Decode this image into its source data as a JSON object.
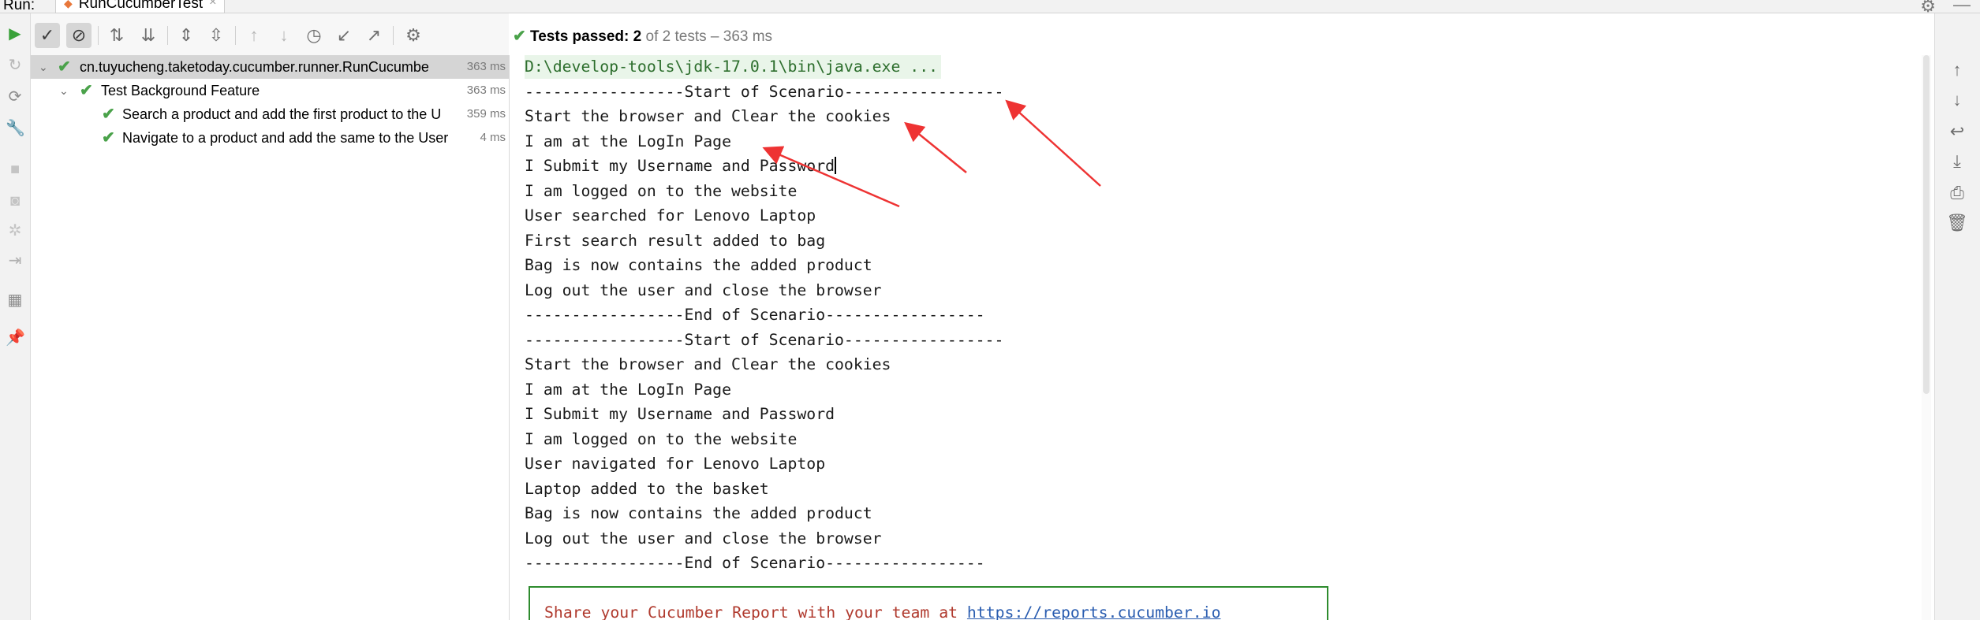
{
  "topbar": {
    "run_label": "Run:",
    "tab_label": "RunCucumberTest",
    "tab_close": "×"
  },
  "toolbar": {
    "icons": [
      "show-passed-icon",
      "show-ignored-icon",
      "sort-alpha-icon",
      "sort-duration-icon",
      "expand-all-icon",
      "collapse-all-icon",
      "prev-failed-icon",
      "next-failed-icon",
      "history-icon",
      "import-tests-icon",
      "export-tests-icon",
      "settings-icon"
    ]
  },
  "status": {
    "label": "Tests passed:",
    "passed": "2",
    "of_total": "of 2 tests",
    "separator": "–",
    "duration": "363 ms"
  },
  "tree": {
    "root": {
      "name": "cn.tuyucheng.taketoday.cucumber.runner.RunCucumbe",
      "duration": "363 ms"
    },
    "feature": {
      "name": "Test Background Feature",
      "duration": "363 ms"
    },
    "tests": [
      {
        "name": "Search a product and add the first product to the U",
        "duration": "359 ms"
      },
      {
        "name": "Navigate to a product and add the same to the User",
        "duration": "4 ms"
      }
    ]
  },
  "console": {
    "command": "D:\\develop-tools\\jdk-17.0.1\\bin\\java.exe ...",
    "lines": [
      "-----------------Start of Scenario-----------------",
      "Start the browser and Clear the cookies",
      "I am at the LogIn Page",
      "I Submit my Username and Password",
      "I am logged on to the website",
      "User searched for Lenovo Laptop",
      "First search result added to bag",
      "Bag is now contains the added product",
      "Log out the user and close the browser",
      "-----------------End of Scenario-----------------",
      "-----------------Start of Scenario-----------------",
      "Start the browser and Clear the cookies",
      "I am at the LogIn Page",
      "I Submit my Username and Password",
      "I am logged on to the website",
      "User navigated for Lenovo Laptop",
      "Laptop added to the basket",
      "Bag is now contains the added product",
      "Log out the user and close the browser",
      "-----------------End of Scenario-----------------"
    ],
    "share_text": "Share your Cucumber Report with your team at ",
    "share_link": "https://reports.cucumber.io"
  },
  "colors": {
    "pass_green": "#4aa24a",
    "annotation_red": "#ee3333",
    "share_text_red": "#b03a2e",
    "link_blue": "#2a5db0"
  }
}
